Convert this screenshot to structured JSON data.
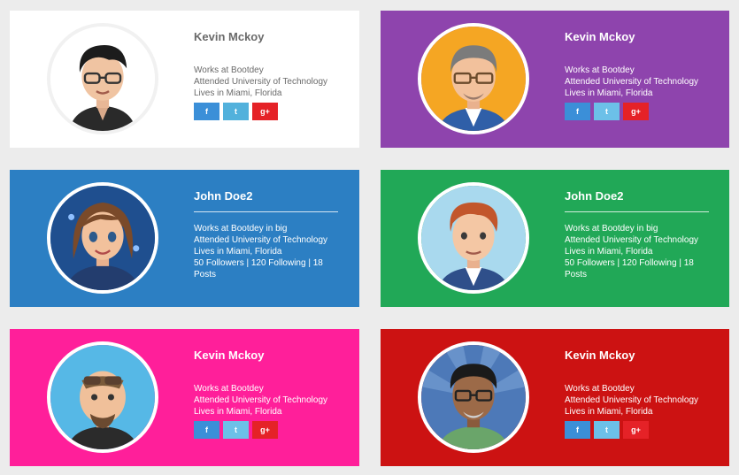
{
  "cards": [
    {
      "name": "Kevin Mckoy",
      "lines": [
        "Works at Bootdey",
        "Attended University of Technology",
        "Lives in Miami, Florida"
      ],
      "social": [
        "f",
        "t",
        "g+"
      ],
      "bg": "#ffffff",
      "text_color": "#6a6a6a",
      "avatar": "avatar-dark-hair-glasses"
    },
    {
      "name": "Kevin Mckoy",
      "lines": [
        "Works at Bootdey",
        "Attended University of Technology",
        "Lives in Miami, Florida"
      ],
      "social": [
        "f",
        "t",
        "g+"
      ],
      "bg": "#8e44ad",
      "text_color": "#ffffff",
      "avatar": "avatar-gray-hair-glasses"
    },
    {
      "name": "John Doe2",
      "lines": [
        "Works at Bootdey in big",
        "Attended University of Technology",
        "Lives in Miami, Florida",
        "50 Followers | 120 Following | 18",
        "Posts"
      ],
      "bg": "#2c7fc3",
      "text_color": "#ffffff",
      "avatar": "avatar-brown-hair-woman"
    },
    {
      "name": "John Doe2",
      "lines": [
        "Works at Bootdey in big",
        "Attended University of Technology",
        "Lives in Miami, Florida",
        "50 Followers | 120 Following | 18",
        "Posts"
      ],
      "bg": "#21a857",
      "text_color": "#ffffff",
      "avatar": "avatar-red-hair-man"
    },
    {
      "name": "Kevin Mckoy",
      "lines": [
        "Works at Bootdey",
        "Attended University of Technology",
        "Lives in Miami, Florida"
      ],
      "social": [
        "f",
        "t",
        "g+"
      ],
      "bg": "#ff1f9a",
      "text_color": "#ffffff",
      "avatar": "avatar-sunglasses-man"
    },
    {
      "name": "Kevin Mckoy",
      "lines": [
        "Works at Bootdey",
        "Attended University of Technology",
        "Lives in Miami, Florida"
      ],
      "social": [
        "f",
        "t",
        "g+"
      ],
      "bg": "#cc1212",
      "text_color": "#ffffff",
      "avatar": "avatar-dark-skin-glasses"
    }
  ]
}
